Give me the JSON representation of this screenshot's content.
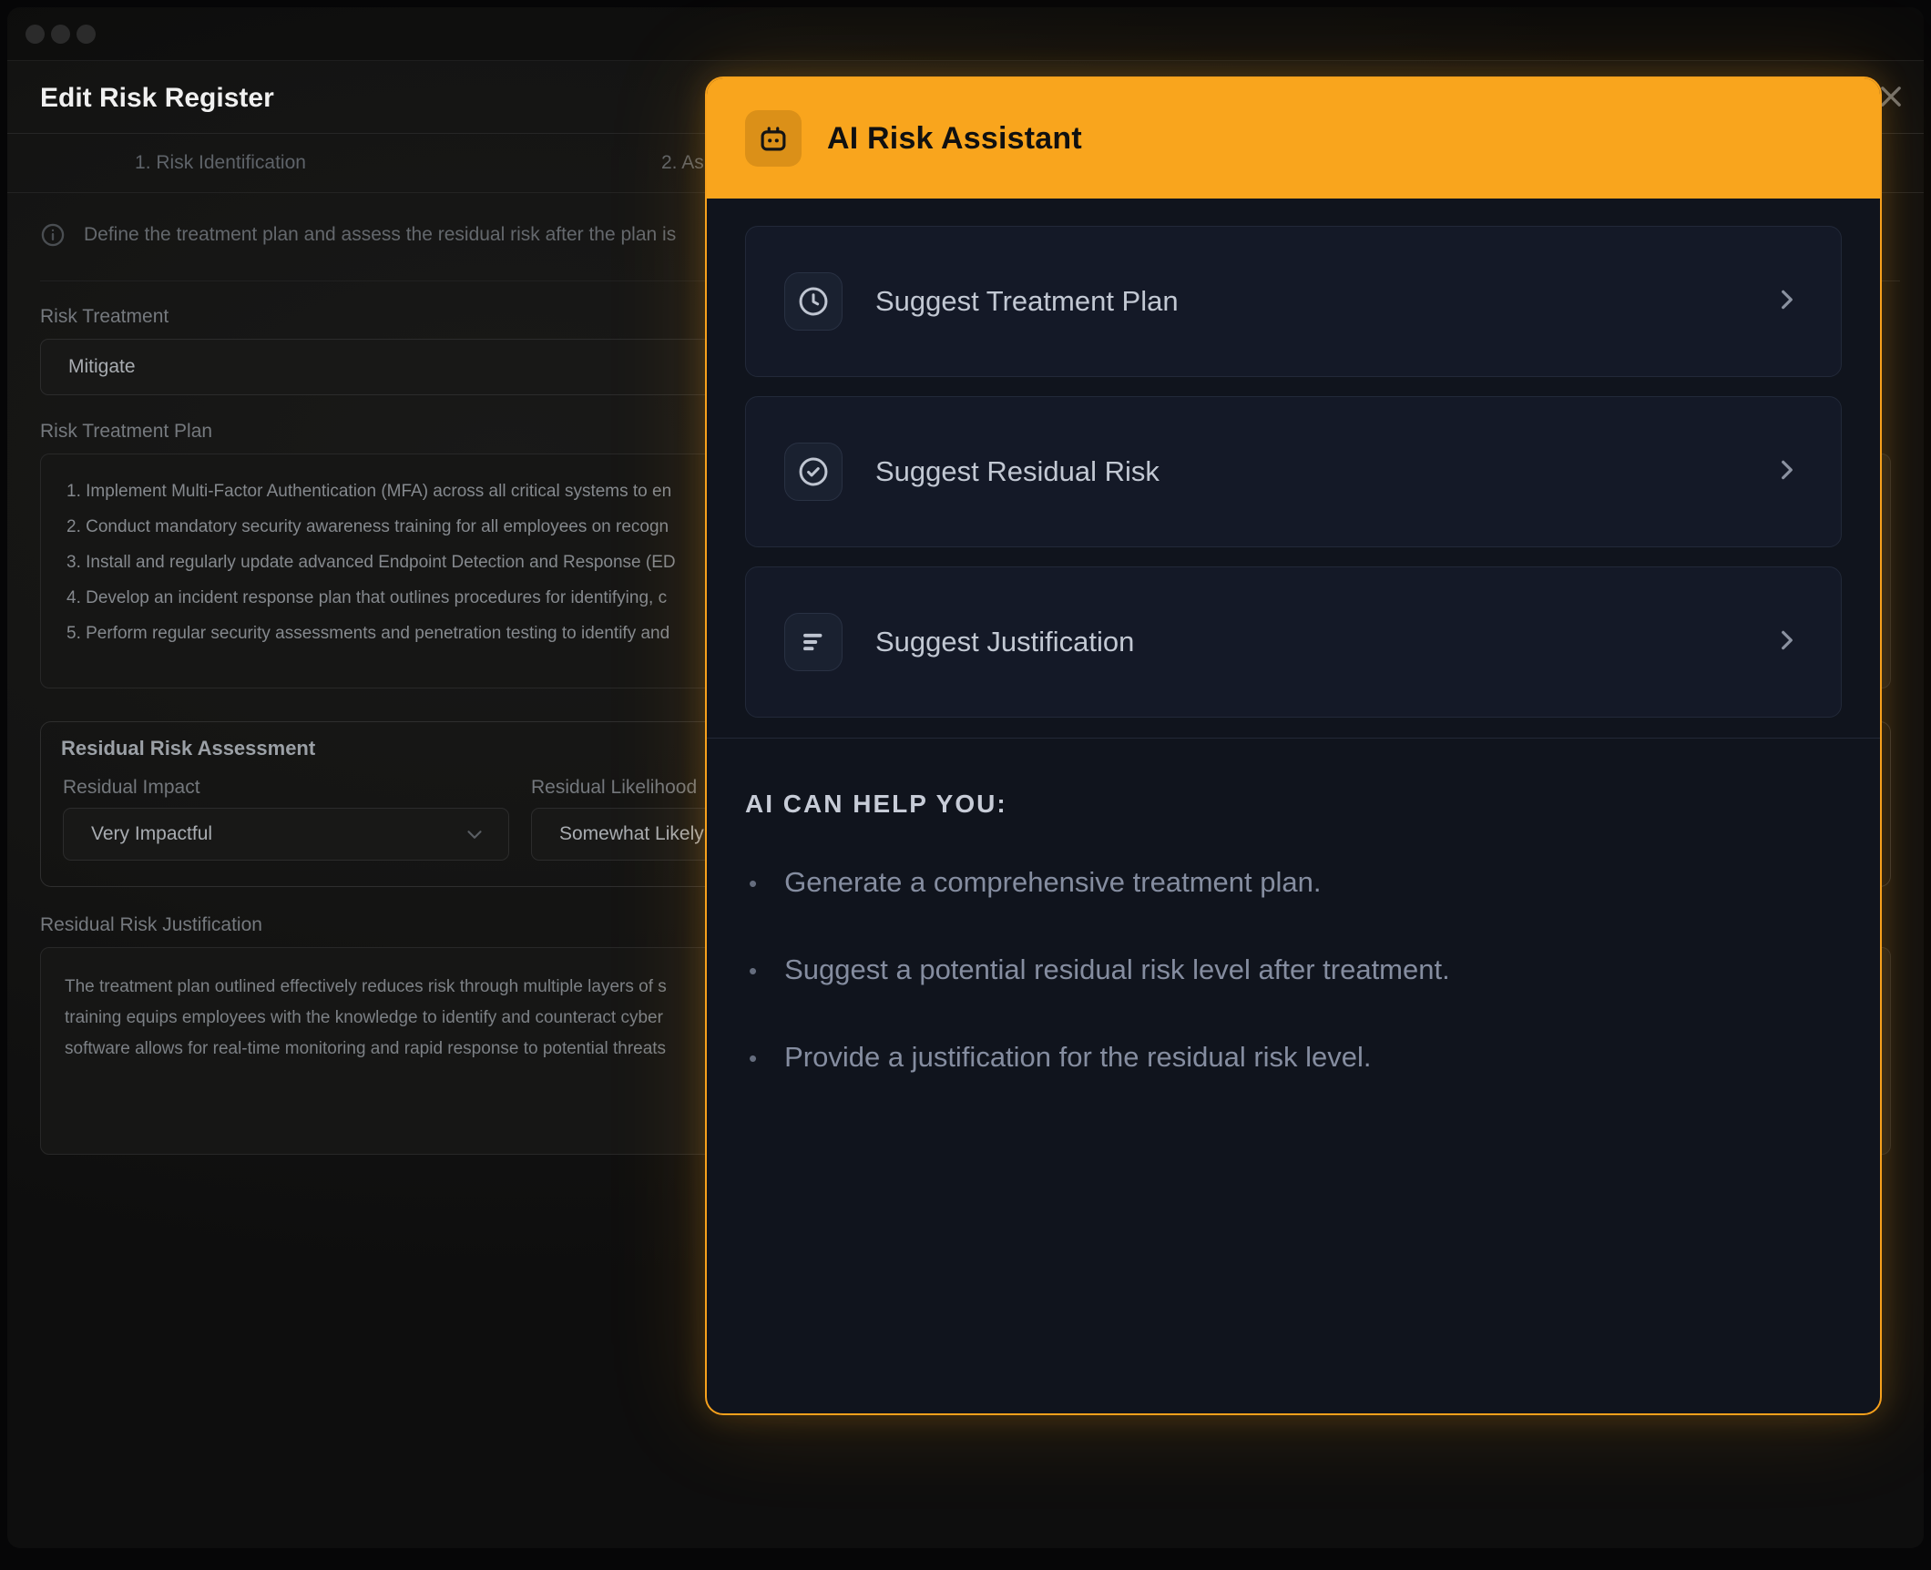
{
  "window": {
    "title": "Edit Risk Register",
    "tabs": [
      {
        "label": "1. Risk Identification"
      },
      {
        "label": "2. As"
      }
    ],
    "info_text": "Define the treatment plan and assess the residual risk after the plan is",
    "form": {
      "risk_treatment": {
        "label": "Risk Treatment",
        "value": "Mitigate"
      },
      "plan": {
        "label": "Risk Treatment Plan",
        "items": [
          "1. Implement Multi-Factor Authentication (MFA) across all critical systems to en",
          "2. Conduct mandatory security awareness training for all employees on recogn",
          "3. Install and regularly update advanced Endpoint Detection and Response (ED",
          "4. Develop an incident response plan that outlines procedures for identifying, c",
          "5. Perform regular security assessments and penetration testing to identify and"
        ]
      },
      "residual": {
        "heading": "Residual Risk Assessment",
        "impact": {
          "label": "Residual Impact",
          "value": "Very Impactful"
        },
        "likelihood": {
          "label": "Residual Likelihood",
          "value": "Somewhat Likely"
        }
      },
      "justification": {
        "label": "Residual Risk Justification",
        "lines": [
          "The treatment plan outlined effectively reduces risk through multiple layers of s",
          "training equips employees with the knowledge to identify and counteract cyber",
          "software allows for real-time monitoring and rapid response to potential threats"
        ]
      }
    }
  },
  "modal": {
    "title": "AI Risk Assistant",
    "accent_color": "#F9A51D",
    "actions": [
      {
        "label": "Suggest Treatment Plan",
        "icon": "clock-icon"
      },
      {
        "label": "Suggest Residual Risk",
        "icon": "check-circle-icon"
      },
      {
        "label": "Suggest Justification",
        "icon": "align-left-icon"
      }
    ],
    "help": {
      "heading": "AI CAN HELP YOU:",
      "bullets": [
        "Generate a comprehensive treatment plan.",
        "Suggest a potential residual risk level after treatment.",
        "Provide a justification for the residual risk level."
      ]
    }
  }
}
